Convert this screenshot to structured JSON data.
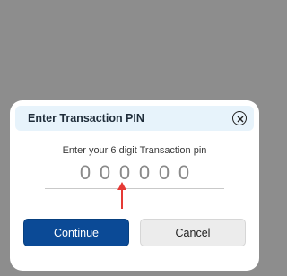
{
  "dialog": {
    "title": "Enter Transaction PIN",
    "close_icon": "close-circle-icon",
    "instruction": "Enter your 6 digit Transaction pin",
    "pin_digits": [
      "0",
      "0",
      "0",
      "0",
      "0",
      "0"
    ],
    "continue_label": "Continue",
    "cancel_label": "Cancel"
  },
  "annotation": {
    "arrow_icon": "red-arrow-up-icon",
    "color": "#e53935"
  },
  "colors": {
    "backdrop": "#8d8d8d",
    "header_bg": "#e7f3fb",
    "primary": "#0b4a96",
    "secondary_bg": "#ececec"
  }
}
